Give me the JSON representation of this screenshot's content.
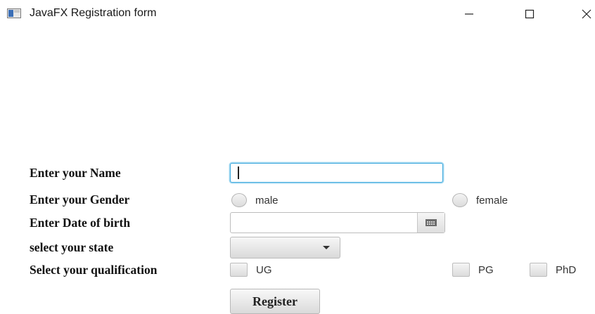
{
  "window": {
    "title": "JavaFX Registration form",
    "icon": "javafx-window-icon",
    "controls": {
      "minimize": "—",
      "maximize": "☐",
      "close": "✕"
    }
  },
  "form": {
    "name_label": "Enter your Name",
    "name_value": "",
    "gender_label": "Enter your Gender",
    "gender_options": [
      "male",
      "female"
    ],
    "dob_label": "Enter Date of birth",
    "dob_value": "",
    "state_label": "select your state",
    "state_selected": "",
    "qualification_label": "Select your qualification",
    "qualification_options": [
      "UG",
      "PG",
      "PhD"
    ],
    "register_label": "Register"
  },
  "colors": {
    "focus": "#3fa9dd",
    "background": "#ffffff",
    "text": "#111111"
  }
}
